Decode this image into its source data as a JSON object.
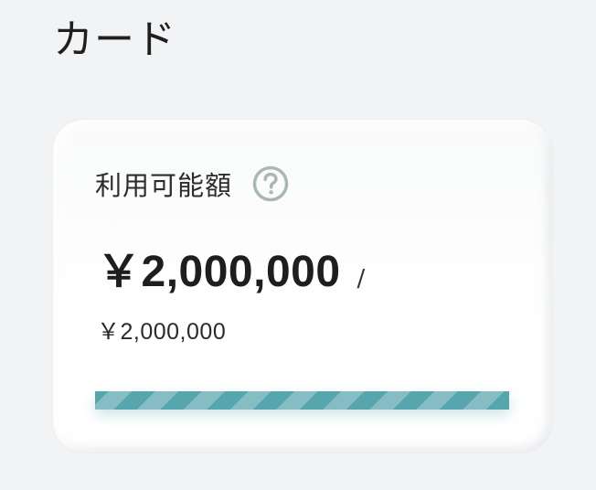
{
  "header": {
    "title": "カード"
  },
  "card": {
    "label": "利用可能額",
    "help_icon": "question-circle-icon",
    "available_amount": "￥2,000,000",
    "separator": "/",
    "total_amount": "￥2,000,000",
    "usage_progress": 1.0
  },
  "colors": {
    "background": "#f2f3f5",
    "card": "#ffffff",
    "progress_primary": "#57a5ad",
    "progress_secondary": "#86bdc4",
    "icon": "#aab7b5"
  }
}
